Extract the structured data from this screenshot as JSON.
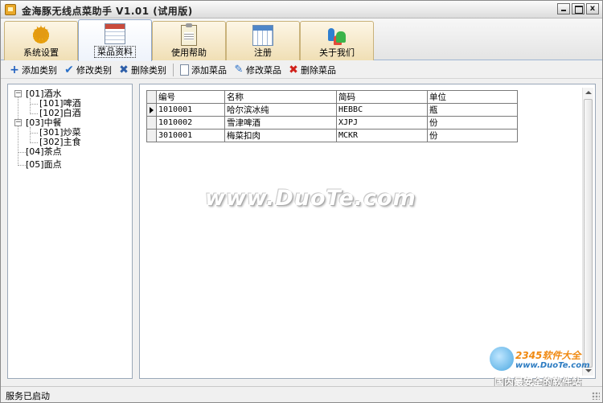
{
  "window": {
    "title": "金海豚无线点菜助手 V1.01 (试用版)",
    "min_label": "",
    "close_label": "x"
  },
  "tabs": [
    {
      "label": "系统设置",
      "icon": "gear-icon"
    },
    {
      "label": "菜品资料",
      "icon": "spreadsheet-icon",
      "active": true
    },
    {
      "label": "使用帮助",
      "icon": "clipboard-icon"
    },
    {
      "label": "注册",
      "icon": "calendar-icon"
    },
    {
      "label": "关于我们",
      "icon": "people-icon"
    }
  ],
  "toolbar": {
    "add_category": "添加类别",
    "edit_category": "修改类别",
    "delete_category": "删除类别",
    "add_dish": "添加菜品",
    "edit_dish": "修改菜品",
    "delete_dish": "删除菜品",
    "icons": {
      "plus": "+",
      "check": "✔",
      "x": "✖",
      "pen": "✎",
      "red_x": "✖"
    }
  },
  "tree": {
    "collapse_glyph": "−",
    "nodes": [
      {
        "label": "[01]酒水",
        "level": 0,
        "expanded": true
      },
      {
        "label": "[101]啤酒",
        "level": 1
      },
      {
        "label": "[102]白酒",
        "level": 1
      },
      {
        "label": "[03]中餐",
        "level": 0,
        "expanded": true
      },
      {
        "label": "[301]炒菜",
        "level": 1
      },
      {
        "label": "[302]主食",
        "level": 1
      },
      {
        "label": "[04]茶点",
        "level": 0
      },
      {
        "label": "[05]面点",
        "level": 0
      }
    ]
  },
  "grid": {
    "columns": [
      "编号",
      "名称",
      "简码",
      "单位"
    ],
    "rows": [
      [
        "1010001",
        "哈尔滨冰纯",
        "HEBBC",
        "瓶"
      ],
      [
        "1010002",
        "雪津啤酒",
        "XJPJ",
        "份"
      ],
      [
        "3010001",
        "梅菜扣肉",
        "MCKR",
        "份"
      ]
    ],
    "selected_row": 0
  },
  "watermark": "www.DuoTe.com",
  "logo": {
    "name": "2345软件大全",
    "url": "www.DuoTe.com",
    "tagline": "国内最安全的软件站"
  },
  "status": {
    "text": "服务已启动"
  },
  "colors": {
    "accent": "#2a70c8",
    "delete_red": "#d0201a",
    "tab_inactive": "#f0dfb5"
  }
}
